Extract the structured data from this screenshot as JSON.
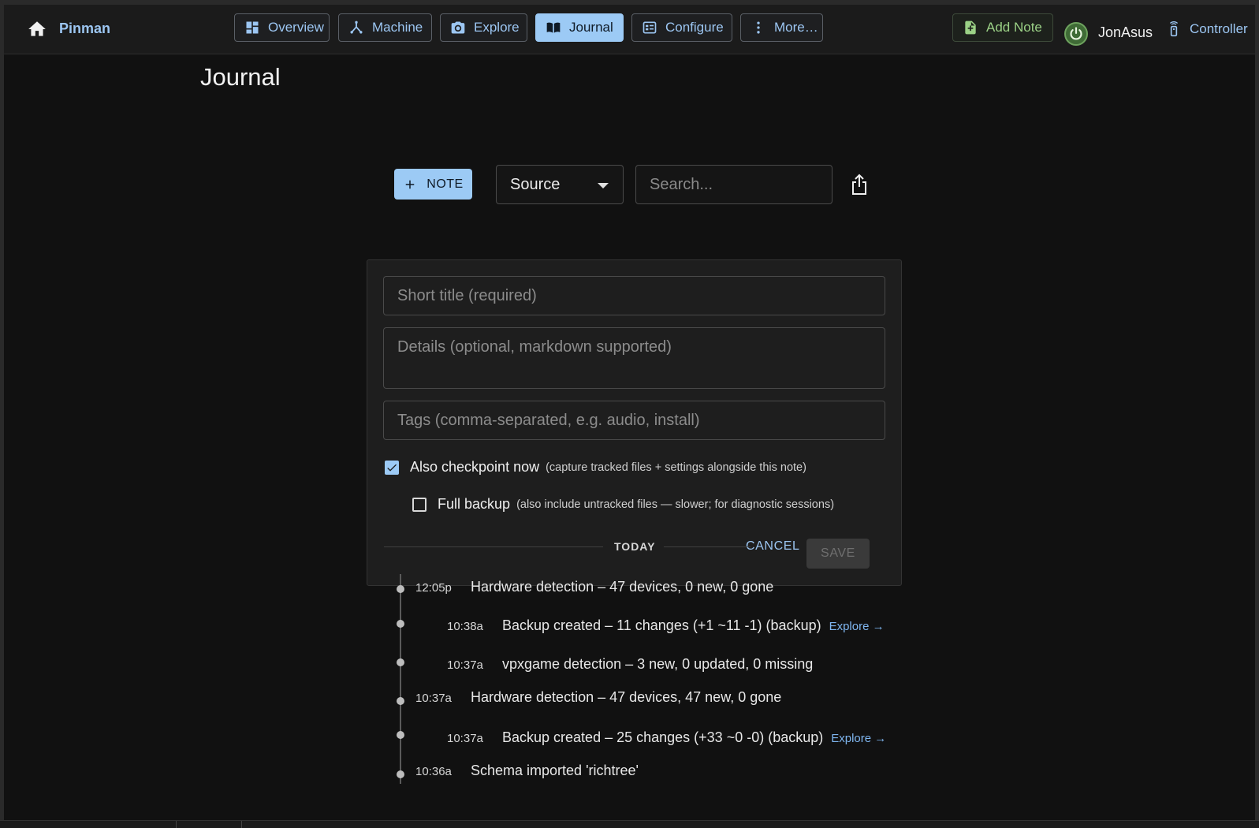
{
  "app": {
    "brand": "Pinman"
  },
  "nav": {
    "overview": "Overview",
    "machine": "Machine",
    "explore": "Explore",
    "journal": "Journal",
    "configure": "Configure",
    "more": "More…"
  },
  "header_right": {
    "add_note": "Add Note",
    "user": "JonAsus",
    "controller": "Controller"
  },
  "page": {
    "title": "Journal"
  },
  "toolbar": {
    "note_button": "NOTE",
    "source_select": "Source",
    "search_placeholder": "Search..."
  },
  "note_form": {
    "title_placeholder": "Short title (required)",
    "details_placeholder": "Details (optional, markdown supported)",
    "tags_placeholder": "Tags (comma-separated, e.g. audio, install)",
    "checkpoint_label": "Also checkpoint now",
    "checkpoint_hint": "(capture tracked files + settings alongside this note)",
    "checkpoint_checked": true,
    "full_backup_label": "Full backup",
    "full_backup_hint": "(also include untracked files — slower; for diagnostic sessions)",
    "full_backup_checked": false,
    "cancel": "CANCEL",
    "save": "SAVE"
  },
  "timeline": {
    "group_label": "TODAY",
    "entries": [
      {
        "time": "12:05p",
        "text": "Hardware detection – 47 devices, 0 new, 0 gone",
        "link": ""
      },
      {
        "time": "10:38a",
        "text": "Backup created – 11 changes (+1 ~11 -1) (backup)",
        "link": "Explore →"
      },
      {
        "time": "10:37a",
        "text": "vpxgame detection – 3 new, 0 updated, 0 missing",
        "link": ""
      },
      {
        "time": "10:37a",
        "text": "Hardware detection – 47 devices, 47 new, 0 gone",
        "link": ""
      },
      {
        "time": "10:37a",
        "text": "Backup created – 25 changes (+33 ~0 -0) (backup)",
        "link": "Explore →"
      },
      {
        "time": "10:36a",
        "text": "Schema imported 'richtree'",
        "link": ""
      }
    ]
  },
  "colors": {
    "accent": "#9ccaf5",
    "link": "#7fb6f0",
    "background": "#111111",
    "card": "#1e1e1e",
    "add_note_green": "#9bd186"
  }
}
